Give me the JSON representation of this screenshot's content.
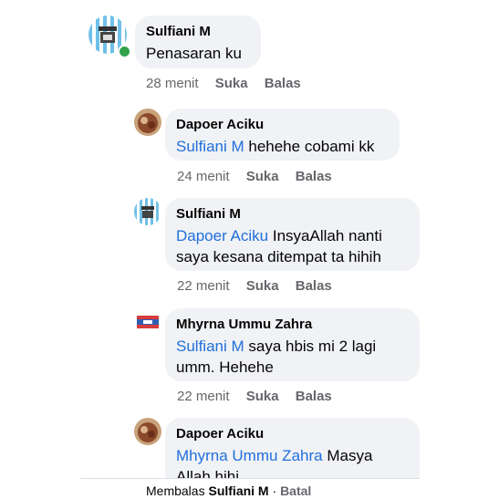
{
  "comments": [
    {
      "author": "Sulfiani M",
      "mention": "",
      "text": "Penasaran ku",
      "time": "28 menit",
      "like": "Suka",
      "reply": "Balas",
      "avatar": "striped-shop-avatar",
      "online": true
    },
    {
      "author": "Dapoer Aciku",
      "mention": "Sulfiani M",
      "text": " hehehe cobami kk",
      "time": "24 menit",
      "like": "Suka",
      "reply": "Balas",
      "avatar": "food-photo-avatar"
    },
    {
      "author": "Sulfiani M",
      "mention": "Dapoer Aciku",
      "text": " InsyaAllah nanti saya kesana ditempat ta hihih",
      "time": "22 menit",
      "like": "Suka",
      "reply": "Balas",
      "avatar": "striped-shop-avatar"
    },
    {
      "author": "Mhyrna Ummu Zahra",
      "mention": "Sulfiani M",
      "text": " saya hbis mi 2 lagi umm. Hehehe",
      "time": "22 menit",
      "like": "Suka",
      "reply": "Balas",
      "avatar": "flag-logo-avatar"
    },
    {
      "author": "Dapoer Aciku",
      "mention": "Mhyrna Ummu Zahra",
      "text": " Masya Allah hihi",
      "avatar": "food-photo-avatar"
    }
  ],
  "reply_bar": {
    "prefix": "Membalas",
    "name": "Sulfiani M",
    "separator": " · ",
    "cancel": "Batal"
  },
  "colors": {
    "mention": "#216fdb",
    "bubble": "#f0f2f5",
    "meta": "#65676b",
    "online": "#31a24c"
  }
}
